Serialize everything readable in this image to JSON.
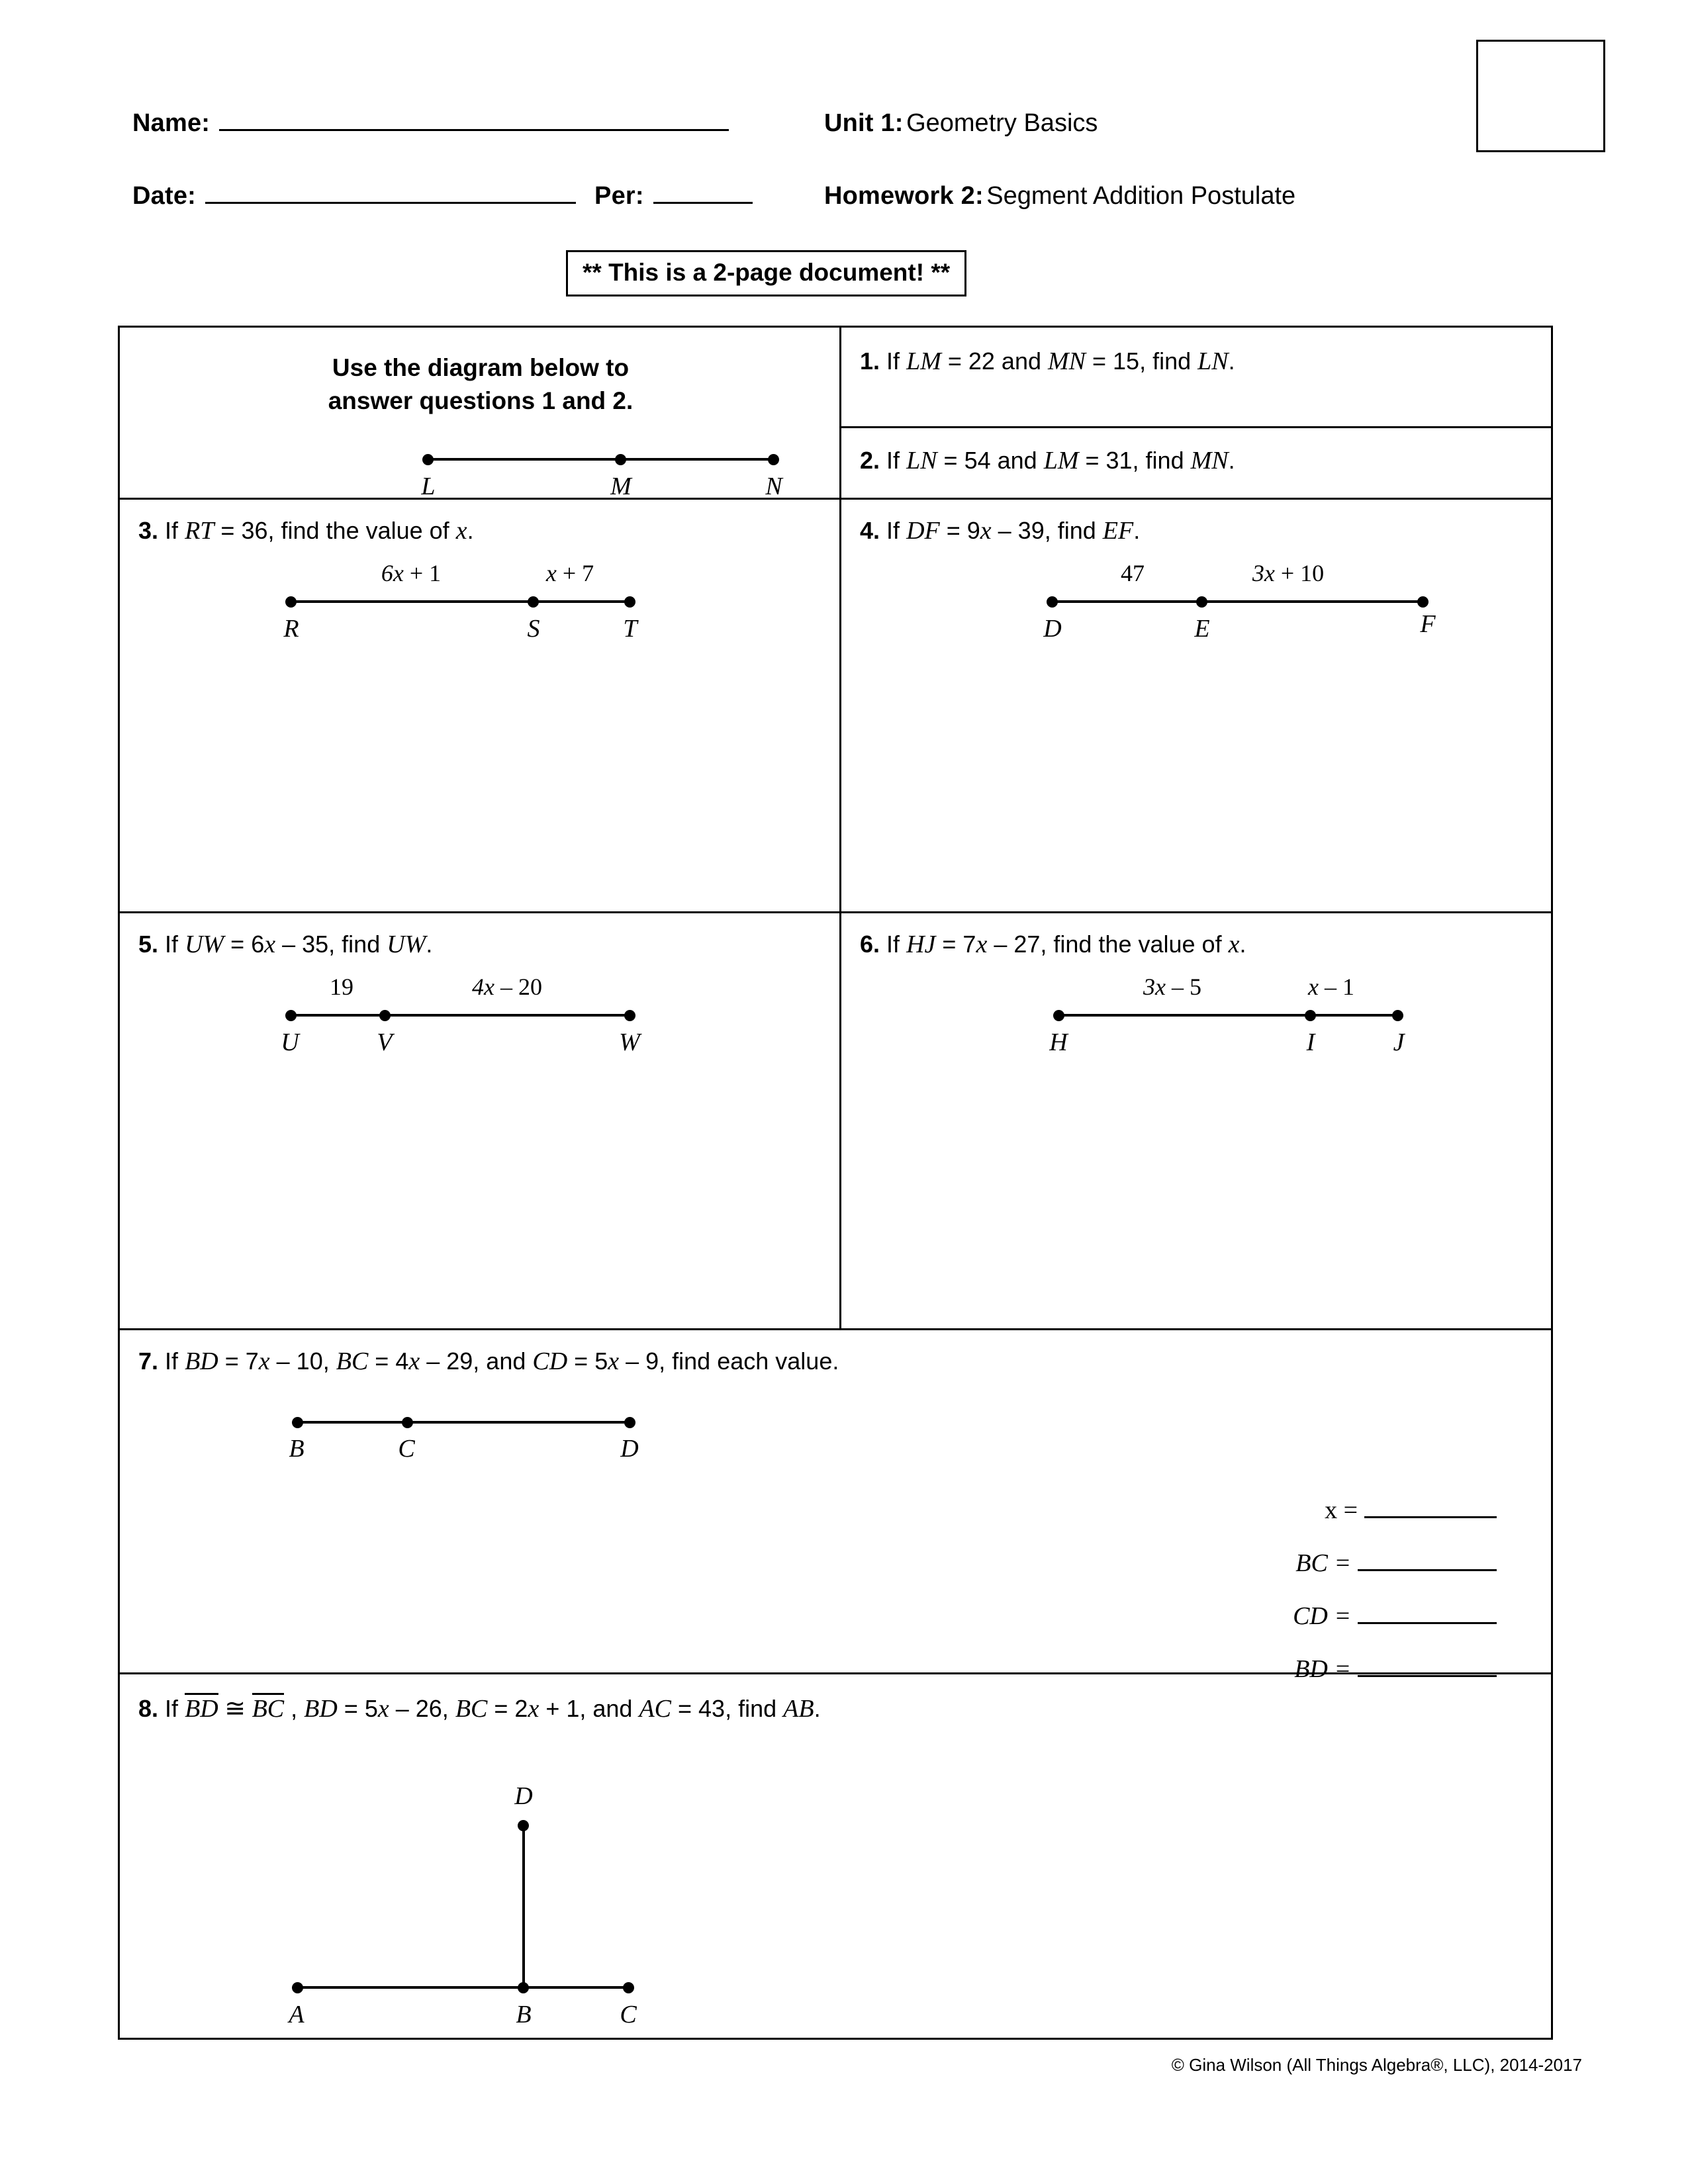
{
  "header": {
    "name_label": "Name:",
    "date_label": "Date:",
    "per_label": "Per:",
    "unit_label": "Unit 1:",
    "unit_title": "Geometry Basics",
    "homework_label": "Homework 2:",
    "homework_title": "Segment Addition Postulate",
    "notice": "** This is a 2-page document! **"
  },
  "instructions": {
    "line1": "Use the diagram below to",
    "line2": "answer questions 1 and 2."
  },
  "diagram_lmn": {
    "points": [
      "L",
      "M",
      "N"
    ]
  },
  "questions": [
    {
      "num": "1.",
      "text_parts": [
        "If ",
        "LM",
        " = 22 and ",
        "MN",
        " = 15, find ",
        "LN",
        "."
      ]
    },
    {
      "num": "2.",
      "text_parts": [
        "If ",
        "LN",
        " = 54 and ",
        "LM",
        " = 31, find ",
        "MN",
        "."
      ]
    },
    {
      "num": "3.",
      "text": "If RT = 36, find the value of x.",
      "points": [
        "R",
        "S",
        "T"
      ],
      "measures": [
        "6x + 1",
        "x + 7"
      ]
    },
    {
      "num": "4.",
      "text": "If DF = 9x – 39, find EF.",
      "points": [
        "D",
        "E",
        "F"
      ],
      "measures": [
        "47",
        "3x + 10"
      ]
    },
    {
      "num": "5.",
      "text": "If UW = 6x – 35, find UW.",
      "points": [
        "U",
        "V",
        "W"
      ],
      "measures": [
        "19",
        "4x – 20"
      ]
    },
    {
      "num": "6.",
      "text": "If HJ = 7x – 27, find the value of x.",
      "points": [
        "H",
        "I",
        "J"
      ],
      "measures": [
        "3x – 5",
        "x – 1"
      ]
    },
    {
      "num": "7.",
      "text": "If BD = 7x – 10, BC = 4x – 29, and CD = 5x – 9, find each value.",
      "points": [
        "B",
        "C",
        "D"
      ],
      "answers": [
        "x =",
        "BC =",
        "CD =",
        "BD ="
      ]
    },
    {
      "num": "8.",
      "text": "If BD ≅ BC , BD = 5x – 26, BC = 2x + 1, and AC = 43, find AB.",
      "points": [
        "A",
        "B",
        "C",
        "D"
      ]
    }
  ],
  "q1": {
    "num": "1.",
    "pre": "If ",
    "v1": "LM",
    "mid1": " = 22 and ",
    "v2": "MN",
    "mid2": " = 15, find ",
    "v3": "LN",
    "end": "."
  },
  "q2": {
    "num": "2.",
    "pre": "If ",
    "v1": "LN",
    "mid1": " = 54 and ",
    "v2": "LM",
    "mid2": " = 31, find ",
    "v3": "MN",
    "end": "."
  },
  "q3": {
    "num": "3.",
    "pre": "If ",
    "v1": "RT",
    "mid1": " = 36, find the value of ",
    "v2": "x",
    "end": ".",
    "m1": "6x + 1",
    "m1_coef": "6",
    "m1_var": "x",
    "m1_rest": " + 1",
    "m2_var": "x",
    "m2_rest": " + 7",
    "p1": "R",
    "p2": "S",
    "p3": "T"
  },
  "q4": {
    "num": "4.",
    "pre": "If ",
    "v1": "DF",
    "mid1": " = 9",
    "v2": "x",
    "mid2": " – 39, find ",
    "v3": "EF",
    "end": ".",
    "m1": "47",
    "m2_coef": "3",
    "m2_var": "x",
    "m2_rest": " + 10",
    "p1": "D",
    "p2": "E",
    "p3": "F"
  },
  "q5": {
    "num": "5.",
    "pre": "If ",
    "v1": "UW",
    "mid1": " = 6",
    "v2": "x",
    "mid2": " – 35, find ",
    "v3": "UW",
    "end": ".",
    "m1": "19",
    "m2_coef": "4",
    "m2_var": "x",
    "m2_rest": " – 20",
    "p1": "U",
    "p2": "V",
    "p3": "W"
  },
  "q6": {
    "num": "6.",
    "pre": "If ",
    "v1": "HJ",
    "mid1": " = 7",
    "v2": "x",
    "mid2": " – 27, find the value of ",
    "v3": "x",
    "end": ".",
    "m1_coef": "3",
    "m1_var": "x",
    "m1_rest": " – 5",
    "m2_var": "x",
    "m2_rest": " – 1",
    "p1": "H",
    "p2": "I",
    "p3": "J"
  },
  "q7": {
    "num": "7.",
    "pre": "If ",
    "v1": "BD",
    "mid1": " = 7",
    "x1": "x",
    "mid2": " – 10, ",
    "v2": "BC",
    "mid3": " = 4",
    "x2": "x",
    "mid4": " – 29, and ",
    "v3": "CD",
    "mid5": " = 5",
    "x3": "x",
    "end": " – 9, find each value.",
    "p1": "B",
    "p2": "C",
    "p3": "D",
    "a1": "x =",
    "a2": "BC =",
    "a3": "CD =",
    "a4": "BD ="
  },
  "q8": {
    "num": "8.",
    "pre": "If ",
    "seg1": "BD",
    "cong": " ≅ ",
    "seg2": "BC",
    "mid1": " , ",
    "v1": "BD",
    "mid2": " = 5",
    "x1": "x",
    "mid3": " – 26, ",
    "v2": "BC",
    "mid4": " = 2",
    "x2": "x",
    "mid5": " + 1, and ",
    "v3": "AC",
    "mid6": " = 43, find ",
    "v4": "AB",
    "end": ".",
    "p1": "A",
    "p2": "B",
    "p3": "C",
    "p4": "D"
  },
  "footer": "© Gina Wilson (All Things Algebra®, LLC), 2014-2017"
}
